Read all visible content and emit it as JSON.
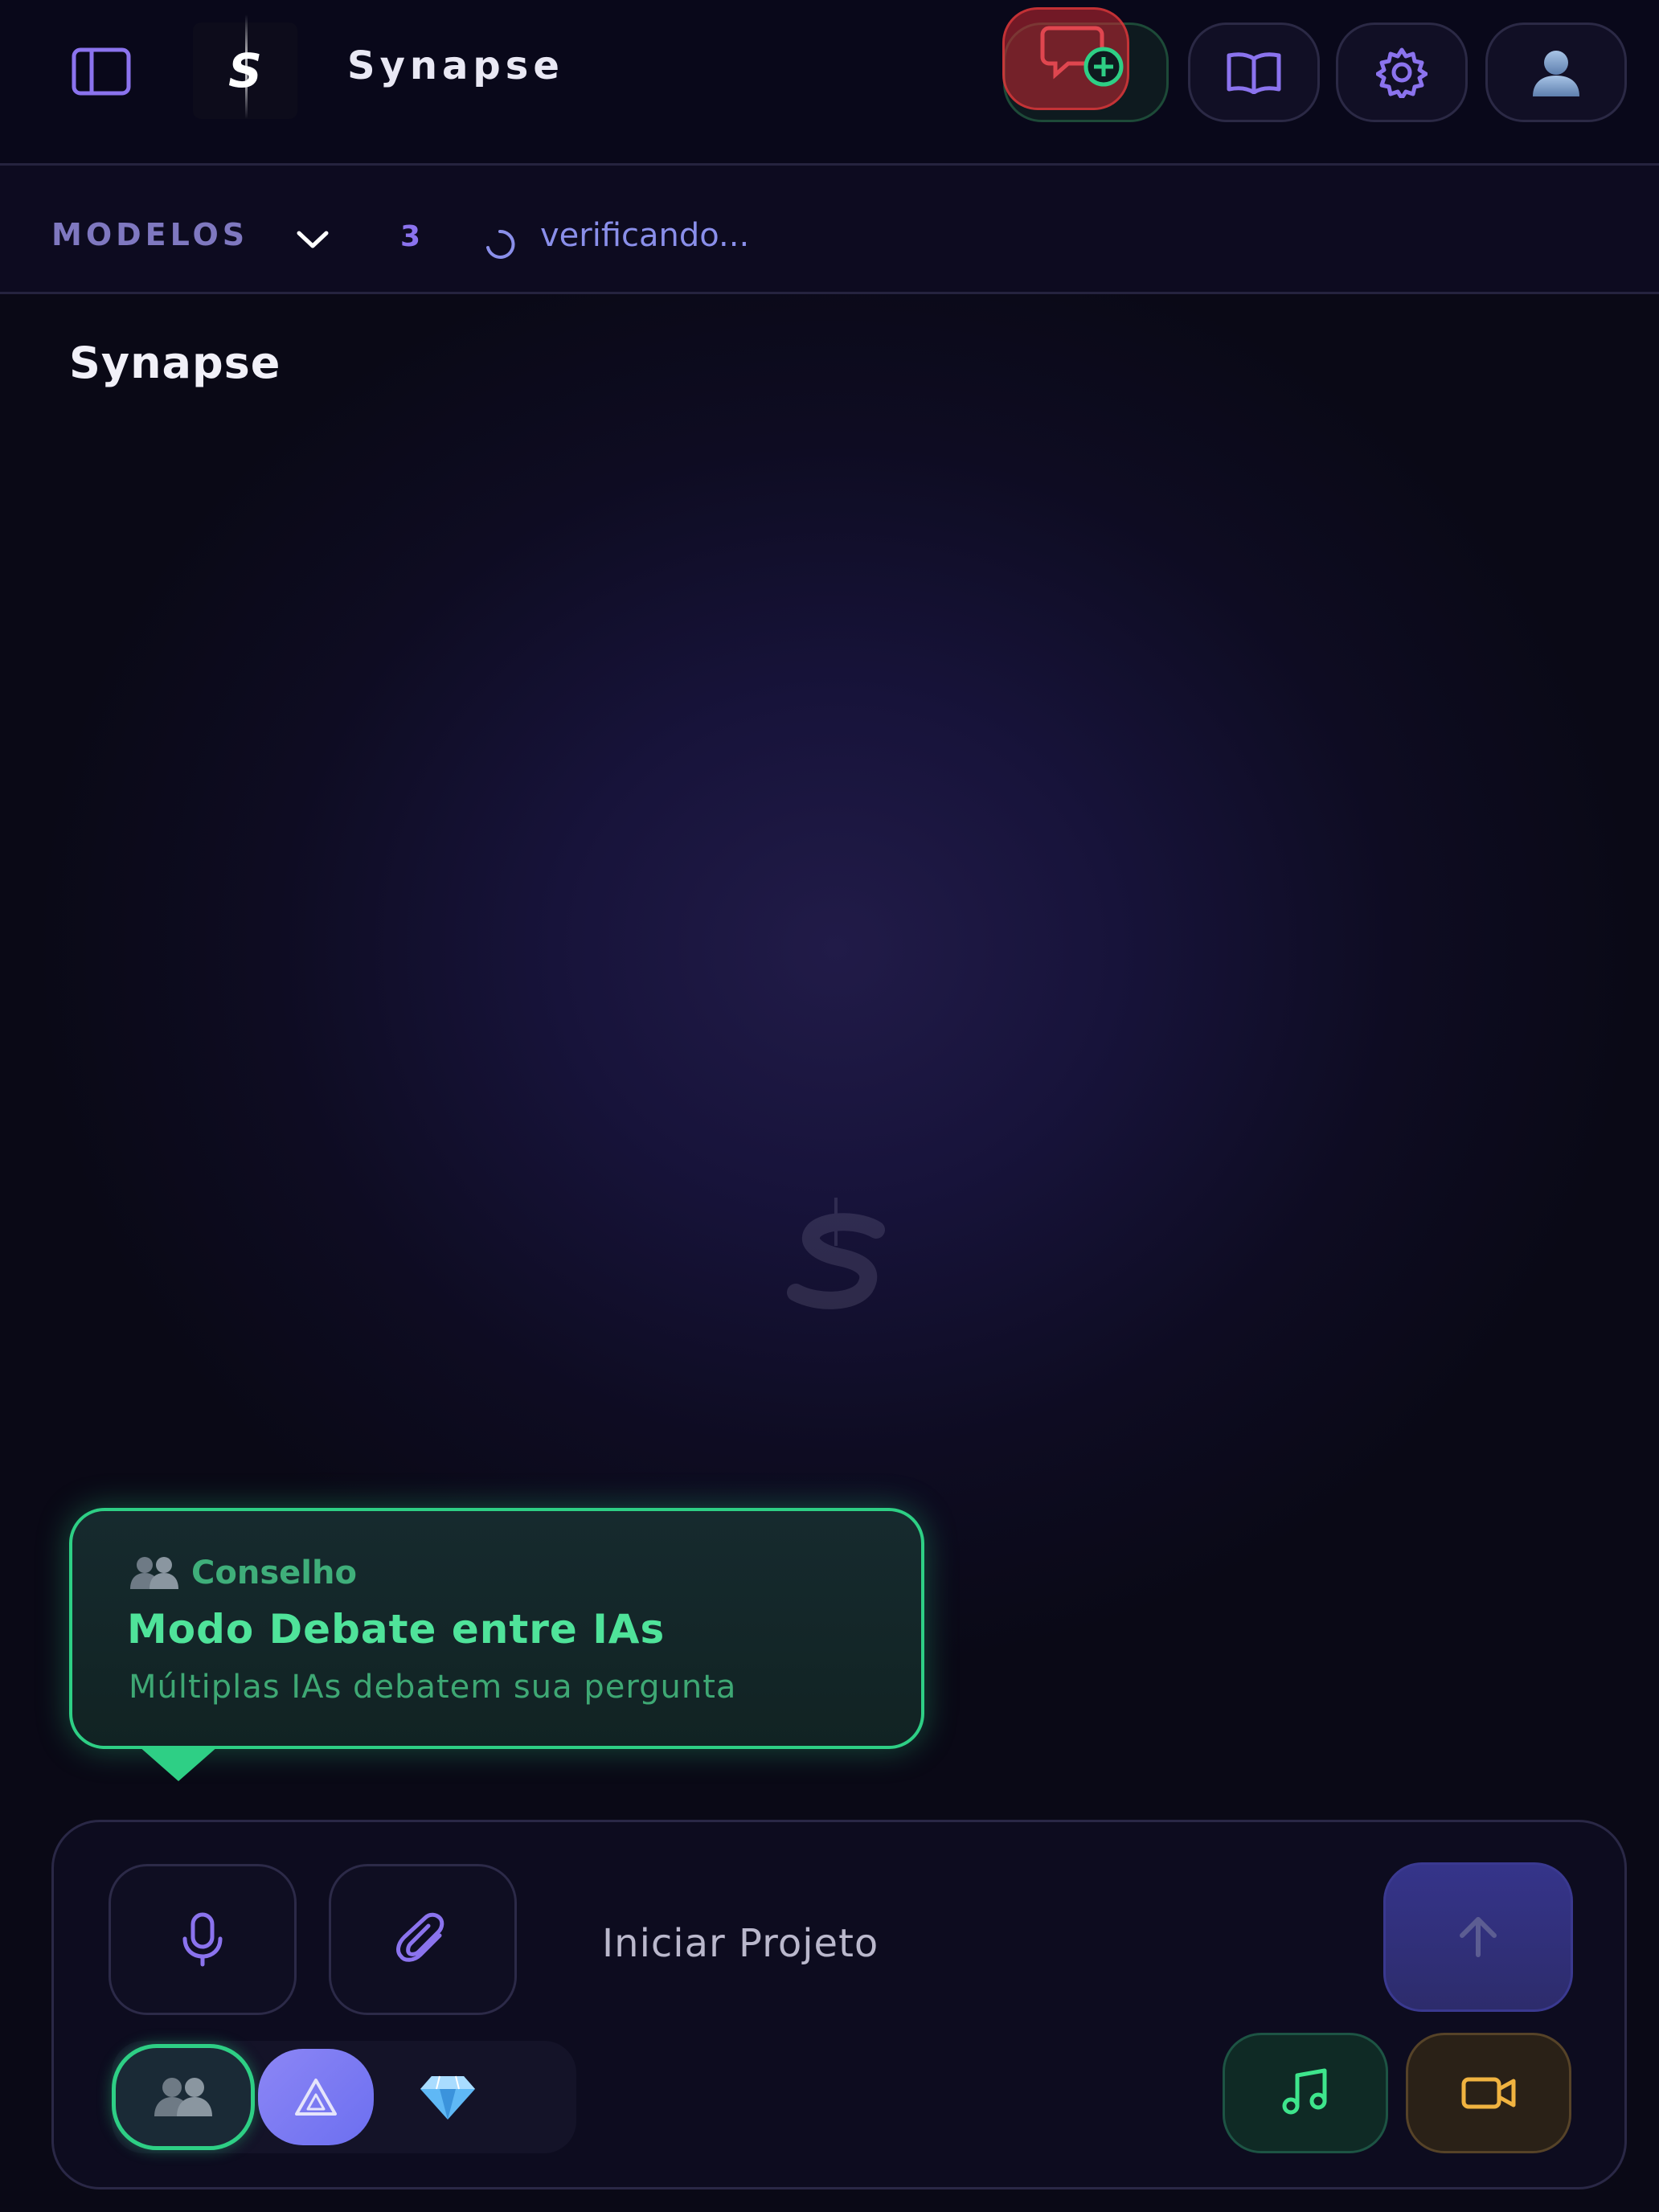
{
  "header": {
    "title": "Synapse",
    "logo_glyph": "S"
  },
  "models_bar": {
    "label": "MODELOS",
    "count": "3",
    "status": "verificando..."
  },
  "main": {
    "title": "Synapse"
  },
  "tooltip": {
    "tag": "Conselho",
    "title": "Modo Debate entre IAs",
    "description": "Múltiplas IAs debatem sua pergunta"
  },
  "composer": {
    "placeholder": "Iniciar Projeto"
  },
  "icons": {
    "sidebar": "sidebar-toggle-icon",
    "new_chat": "chat-plus-icon",
    "library": "book-open-icon",
    "settings": "gear-icon",
    "profile": "user-icon",
    "models_toggle": "chevron-down-icon",
    "status": "spinner-icon",
    "mic": "microphone-icon",
    "attach": "paperclip-icon",
    "send": "arrow-up-icon",
    "debate": "people-icon",
    "mode_two": "triangle-icon",
    "mode_three": "gem-icon",
    "music": "music-note-icon",
    "video": "video-camera-icon"
  },
  "colors": {
    "background": "#0b0a17",
    "accent_purple": "#8b73ee",
    "accent_green": "#2ecf85",
    "accent_orange": "#f0b340",
    "alert_red": "#e0464f"
  }
}
